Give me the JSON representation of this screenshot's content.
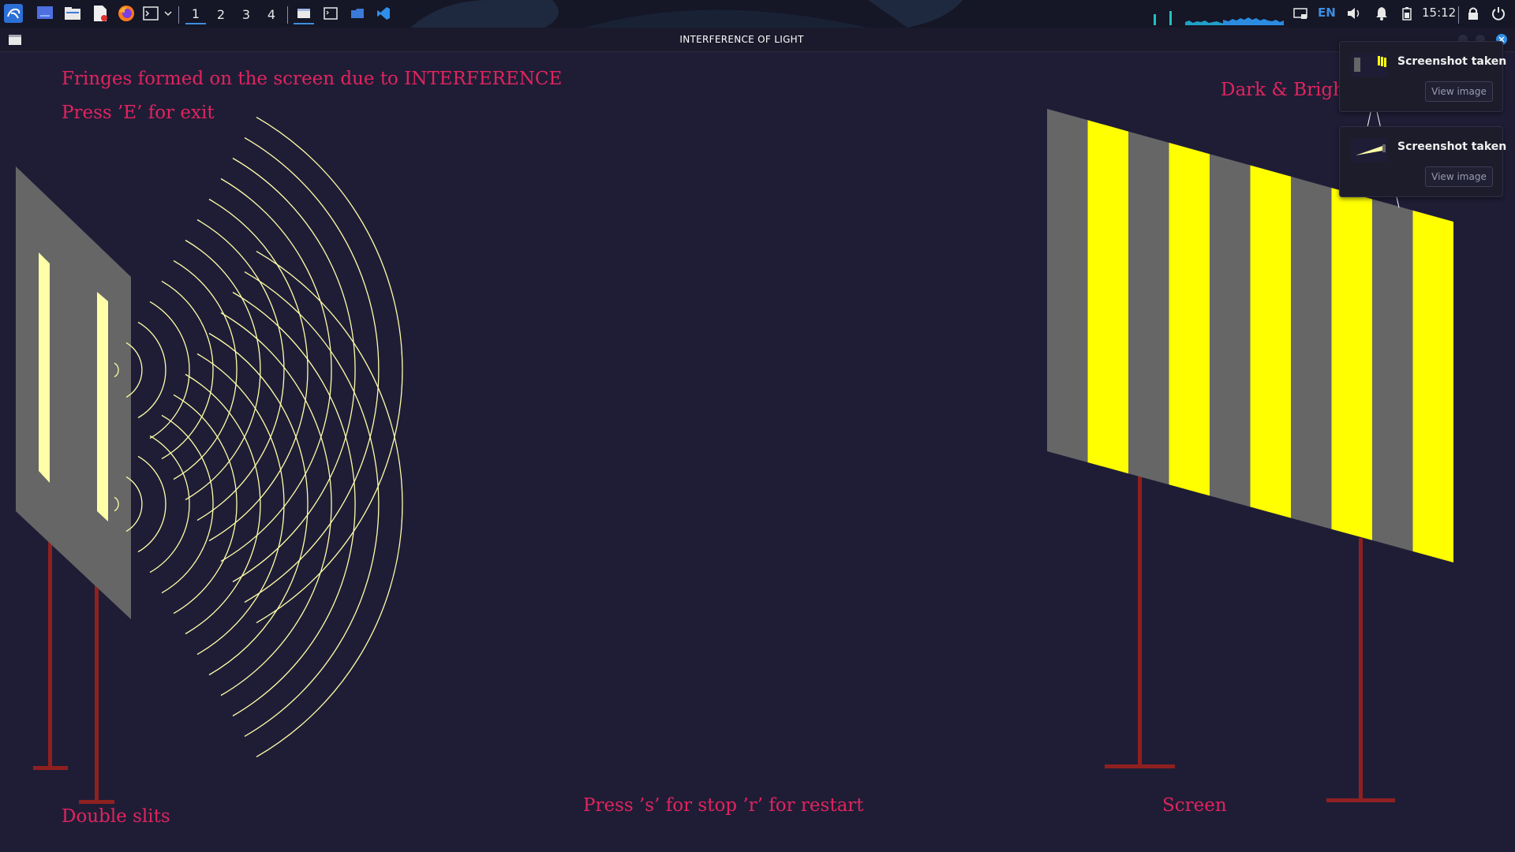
{
  "taskbar": {
    "workspaces": [
      "1",
      "2",
      "3",
      "4"
    ],
    "active_workspace": "1",
    "language": "EN",
    "clock": "15:12",
    "icons": [
      "kali-menu-icon",
      "show-desktop-icon",
      "file-manager-icon",
      "text-editor-icon",
      "firefox-icon",
      "terminal-icon",
      "chevron-down-icon"
    ],
    "accent": "#3d8ee0"
  },
  "window": {
    "title": "INTERFERENCE OF LIGHT"
  },
  "scene": {
    "heading": "Fringes formed on the screen due to INTERFERENCE",
    "exit_hint": "Press ’E’ for exit",
    "fringes_label": "Dark & Bright fringes",
    "controls_hint": "Press ’s’ for stop  ’r’ for restart",
    "slits_label": "Double slits",
    "screen_label": "Screen",
    "colors": {
      "text": "#e0245e",
      "background": "#1f1d36",
      "plate": "#666666",
      "slit": "#ffffa8",
      "wave": "#ffffa8",
      "bright_fringe": "#ffff00",
      "dark_fringe": "#666666",
      "stand": "#8f2020"
    }
  },
  "notifications": [
    {
      "title": "Screenshot taken",
      "button": "View image"
    },
    {
      "title": "Screenshot taken",
      "button": "View image"
    }
  ]
}
